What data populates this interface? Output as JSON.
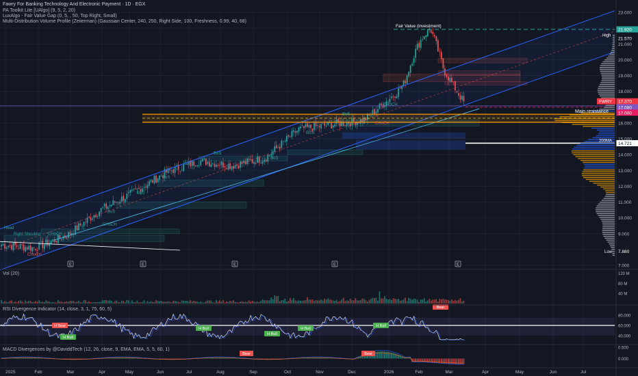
{
  "header": {
    "title": "Fawry For Banking Technology And Electronic Payment · 1D · EGX",
    "ind1": "PA Toolkit Lite [UAlgo] (9, 5, 2, 20)",
    "ind2": "LuxAlgo - Fair Value Gap (0, 5, , 50, Top Right, Small)",
    "ind3": "Multi-Distribution Volume Profile (Zeiierman) (Gaussian Center, 240, 250, Right Side, 100, Freshness, 0.99, 40, 68)"
  },
  "pane_labels": {
    "vol": "Vol (20)",
    "rsi": "RSI Divergence Indicator (14, close, 3, 1, 75, 60, 5)",
    "macd": "MACD Divergences by @DaviddTech (12, 26, close, 9, EMA, EMA, 5, 5, 60, 1)"
  },
  "annotations": {
    "fair_value": "Fair Value (investment)",
    "main_resistance": "Main resistance",
    "ma200": "200MA",
    "high": "High",
    "low": "Low",
    "head": "Head",
    "right_shoulder": "Right Shoulder",
    "chch": "CHoCH",
    "bos": "BoS",
    "earnings": "E",
    "h_bear": "H Bear",
    "h_bull": "H Bull",
    "bear": "Bear"
  },
  "colors": {
    "background": "#131722",
    "up": "#26a69a",
    "down": "#ef5350",
    "channel": "#2962ff",
    "resistance": "#ff9800",
    "rsi_line": "#e0e3eb",
    "rsi_band": "#7e57c2",
    "vp_blue": "#2962ff",
    "vp_orange": "#f7a600",
    "vp_grey": "#b2b5be"
  },
  "chart_data": {
    "type": "candlestick",
    "symbol": "FWRY",
    "timeframe": "1D",
    "exchange": "EGX",
    "y_axis": {
      "ticks": [
        "23.000",
        "22.000",
        "21.000",
        "20.000",
        "19.000",
        "18.000",
        "17.000",
        "16.000",
        "15.000",
        "14.000",
        "13.000",
        "12.000",
        "11.000",
        "10.000",
        "9.000",
        "8.000",
        "7.000"
      ],
      "range": [
        7,
        23
      ]
    },
    "x_axis": {
      "ticks": [
        "2025",
        "Feb",
        "Mar",
        "Apr",
        "May",
        "Jun",
        "Jul",
        "Aug",
        "Sep",
        "Oct",
        "Nov",
        "Dec",
        "2026",
        "Feb",
        "Mar",
        "Apr",
        "May",
        "Jun",
        "Jul"
      ]
    },
    "price_labels": {
      "fair_value": "21.920",
      "high": "21.570",
      "last_symbol": "FWRY",
      "last": "17.370",
      "level_a": "17.080",
      "level_b": "17.000",
      "ma200": "14.721",
      "low": "7.880"
    },
    "levels": {
      "fair_value": 21.92,
      "high": 21.57,
      "last": 17.37,
      "level_a": 17.08,
      "level_b": 17.0,
      "ma200": 14.721,
      "low": 7.88,
      "main_resistance": 16.3
    },
    "monthly_close": [
      8.3,
      8.1,
      8.9,
      10.5,
      11.6,
      12.9,
      13.6,
      13.3,
      13.8,
      15.6,
      15.9,
      16.2,
      18.0,
      20.7,
      17.3
    ],
    "volume_axis": [
      "120 M",
      "80 M",
      "40 M"
    ],
    "rsi_axis": [
      "80.000",
      "60.000",
      "40.000"
    ],
    "rsi_levels": {
      "upper": 75,
      "middle": 60,
      "lower": 40
    },
    "macd_axis": [
      "0.500",
      "0.000"
    ]
  }
}
